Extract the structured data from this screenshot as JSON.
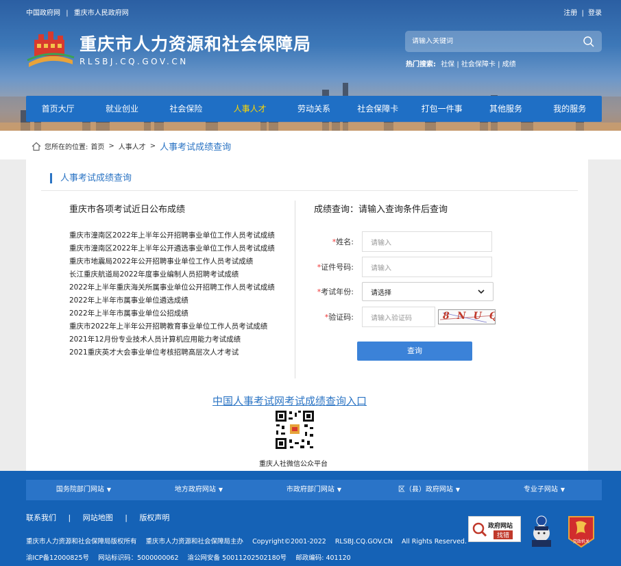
{
  "header": {
    "top_links": [
      "中国政府网",
      "重庆市人民政府网"
    ],
    "top_sep": "|",
    "register": "注册",
    "login": "登录",
    "title_cn": "重庆市人力资源和社会保障局",
    "title_en": "RLSBJ.CQ.GOV.CN",
    "search_placeholder": "请输入关键词",
    "hot_label": "热门搜索:",
    "hot_items": [
      "社保",
      "社会保障卡",
      "成绩"
    ]
  },
  "nav": [
    {
      "label": "首页大厅"
    },
    {
      "label": "就业创业"
    },
    {
      "label": "社会保险"
    },
    {
      "label": "人事人才",
      "active": true
    },
    {
      "label": "劳动关系"
    },
    {
      "label": "社会保障卡"
    },
    {
      "label": "打包一件事"
    },
    {
      "label": "其他服务"
    },
    {
      "label": "我的服务"
    }
  ],
  "breadcrumb": {
    "prefix": "您所在的位置:",
    "home": "首页",
    "level1": "人事人才",
    "current": "人事考试成绩查询",
    "sep": ">"
  },
  "main": {
    "section_title": "人事考试成绩查询",
    "left_title": "重庆市各项考试近日公布成绩",
    "recent_results": [
      "重庆市潼南区2022年上半年公开招聘事业单位工作人员考试成绩",
      "重庆市潼南区2022年上半年公开遴选事业单位工作人员考试成绩",
      "重庆市地震局2022年公开招聘事业单位工作人员考试成绩",
      "长江重庆航道局2022年度事业编制人员招聘考试成绩",
      "2022年上半年重庆海关所属事业单位公开招聘工作人员考试成绩",
      "2022年上半年市属事业单位遴选成绩",
      "2022年上半年市属事业单位公招成绩",
      "重庆市2022年上半年公开招聘教育事业单位工作人员考试成绩",
      "2021年12月份专业技术人员计算机应用能力考试成绩",
      "2021重庆英才大会事业单位考核招聘高层次人才考试"
    ],
    "right_title": "成绩查询：请输入查询条件后查询",
    "form": {
      "name_label": "姓名:",
      "name_placeholder": "请输入",
      "id_label": "证件号码:",
      "id_placeholder": "请输入",
      "year_label": "考试年份:",
      "year_value": "请选择",
      "captcha_label": "验证码:",
      "captcha_placeholder": "请输入验证码",
      "captcha_text": "8NUQ",
      "required_mark": "*",
      "submit": "查询"
    },
    "entry_link": "中国人事考试网考试成绩查询入口",
    "qr_caption": "重庆人社微信公众平台"
  },
  "footer": {
    "site_links": [
      "国务院部门网站",
      "地方政府网站",
      "市政府部门网站",
      "区（县）政府网站",
      "专业子网站"
    ],
    "contact": "联系我们",
    "sitemap": "网站地图",
    "copyright_stmt": "版权声明",
    "sep": "|",
    "line2": [
      "重庆市人力资源和社会保障局版权所有",
      "重庆市人力资源和社会保障局主办",
      "Copyright©2001-2022",
      "RLSBJ.CQ.GOV.CN",
      "All Rights Reserved."
    ],
    "line3": [
      "渝ICP备12000825号",
      "网站标识码：5000000062",
      "渝公网安备 50011202502180号",
      "邮政编码: 401120"
    ],
    "badge_gov_line1": "政府网站",
    "badge_gov_line2": "找错",
    "badge_party_text": "党政机关"
  },
  "colors": {
    "primary": "#1f6fc5",
    "link": "#2b74c4",
    "nav_active": "#ffd700",
    "footer": "#1562b6"
  }
}
